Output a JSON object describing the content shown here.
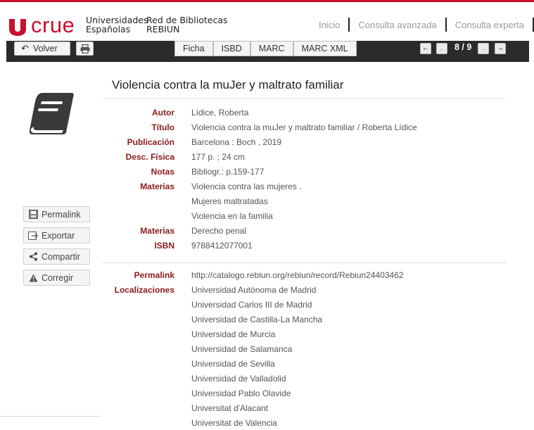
{
  "header": {
    "logo_text": "crue",
    "logo_sub_1": "Universidades\nEspañolas",
    "logo_sub_2": "Red de Bibliotecas\nREBIUN",
    "nav": [
      "Inicio",
      "Consulta avanzada",
      "Consulta experta"
    ],
    "brand_color": "#c8102e"
  },
  "toolbar": {
    "back_label": "Volver",
    "tabs": [
      "Ficha",
      "ISBD",
      "MARC",
      "MARC XML"
    ],
    "pager": {
      "first": "⇤",
      "prev": "←",
      "count": "8 / 9",
      "next": "→",
      "last": "⇥"
    }
  },
  "sidebar": {
    "permalink": "Permalink",
    "export": "Exportar",
    "share": "Compartir",
    "correct": "Corregir"
  },
  "record": {
    "title": "Violencia contra la muJer y maltrato familiar",
    "fields": [
      {
        "label": "Autor",
        "values": [
          "Lídice, Roberta"
        ]
      },
      {
        "label": "Título",
        "values": [
          "Violencia contra la muJer y maltrato familiar / Roberta Lídice"
        ]
      },
      {
        "label": "Publicación",
        "values": [
          "Barcelona : Boch , 2019"
        ]
      },
      {
        "label": "Desc. Física",
        "values": [
          "177 p. ; 24 cm"
        ]
      },
      {
        "label": "Notas",
        "values": [
          "Bibliogr.: p.159-177"
        ]
      },
      {
        "label": "Materias",
        "values": [
          "Violencia contra las mujeres .",
          "Mujeres maltratadas",
          "Violencia en la familia"
        ]
      },
      {
        "label": "Materias",
        "values": [
          "Derecho penal"
        ]
      },
      {
        "label": "ISBN",
        "values": [
          "9788412077001"
        ]
      }
    ],
    "permalink_label": "Permalink",
    "permalink_url": "http://catalogo.rebiun.org/rebiun/record/Rebiun24403462",
    "locations_label": "Localizaciones",
    "locations": [
      "Universidad Autónoma de Madrid",
      "Universidad Carlos III de Madrid",
      "Universidad de Castilla-La Mancha",
      "Universidad de Murcia",
      "Universidad de Salamanca",
      "Universidad de Sevilla",
      "Universidad de Valladolid",
      "Universidad Pablo Olavide",
      "Universitat d'Alacant",
      "Universitat de Valencia"
    ]
  }
}
